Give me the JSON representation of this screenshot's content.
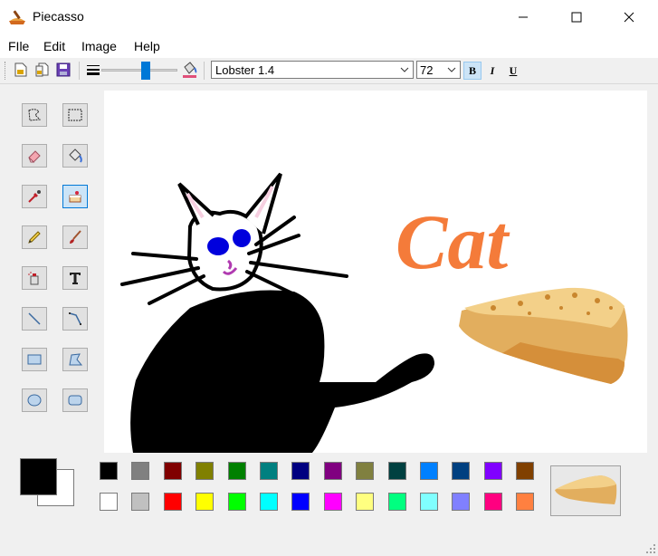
{
  "window": {
    "title": "Piecasso"
  },
  "menu": [
    "FIle",
    "Edit",
    "Image",
    "Help"
  ],
  "toolbar": {
    "font": "Lobster 1.4",
    "size": "72",
    "bold": "B",
    "italic": "I",
    "underline": "U"
  },
  "canvas": {
    "text": "Cat",
    "text_color": "#f47b3a"
  },
  "colors": {
    "foreground": "#000000",
    "background": "#ffffff",
    "palette_row1": [
      "#000000",
      "#808080",
      "#800000",
      "#808000",
      "#008000",
      "#008080",
      "#000080",
      "#800080",
      "#808040",
      "#004040",
      "#0080ff",
      "#004080",
      "#8000ff",
      "#804000"
    ],
    "palette_row2": [
      "#ffffff",
      "#c0c0c0",
      "#ff0000",
      "#ffff00",
      "#00ff00",
      "#00ffff",
      "#0000ff",
      "#ff00ff",
      "#ffff80",
      "#00ff80",
      "#80ffff",
      "#8080ff",
      "#ff0080",
      "#ff8040"
    ]
  }
}
